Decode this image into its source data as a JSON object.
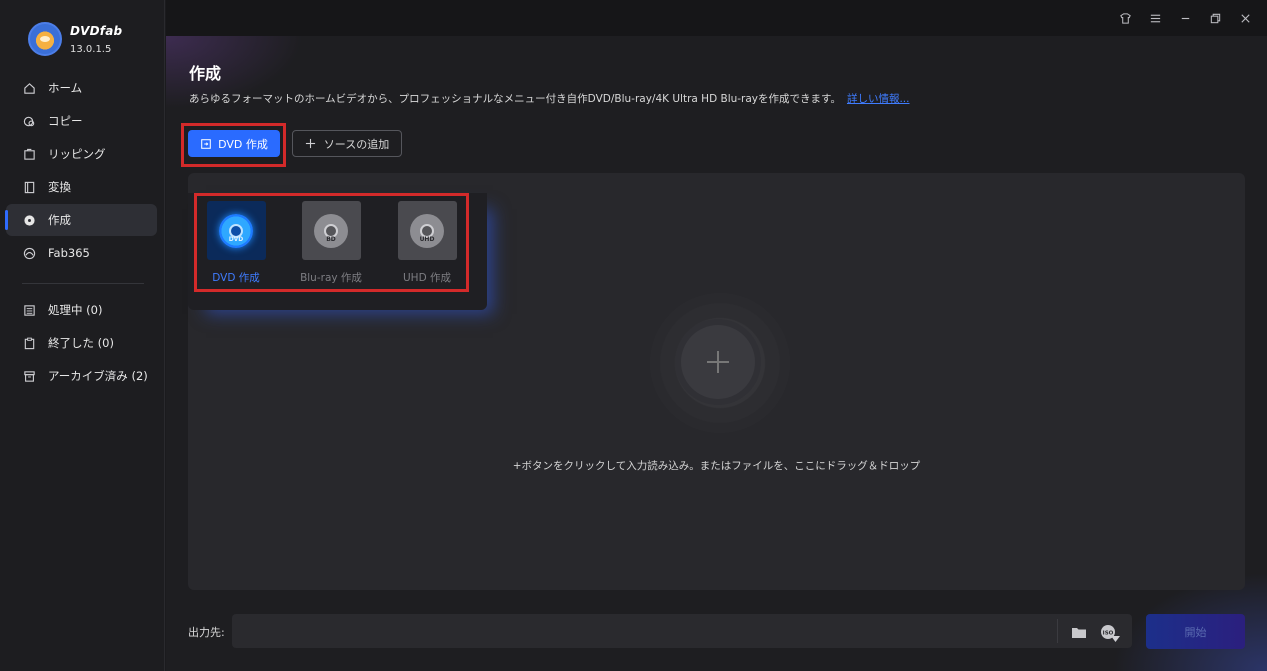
{
  "app": {
    "brand": "DVDfab",
    "version": "13.0.1.5"
  },
  "sidebar": {
    "items": [
      {
        "label": "ホーム",
        "icon": "home-icon"
      },
      {
        "label": "コピー",
        "icon": "copy-icon"
      },
      {
        "label": "リッピング",
        "icon": "ripper-icon"
      },
      {
        "label": "変換",
        "icon": "convert-icon"
      },
      {
        "label": "作成",
        "icon": "creator-icon",
        "active": true
      },
      {
        "label": "Fab365",
        "icon": "fab365-icon"
      }
    ],
    "queue": [
      {
        "label": "処理中 (0)",
        "icon": "processing-icon"
      },
      {
        "label": "終了した (0)",
        "icon": "finished-icon"
      },
      {
        "label": "アーカイブ済み (2)",
        "icon": "archive-icon"
      }
    ]
  },
  "titlebar": {
    "icons": [
      "skin-icon",
      "menu-icon",
      "minimize-icon",
      "restore-icon",
      "close-icon"
    ]
  },
  "main": {
    "title": "作成",
    "description": "あらゆるフォーマットのホームビデオから、プロフェッショナルなメニュー付き自作DVD/Blu-ray/4K Ultra HD Blu-rayを作成できます。",
    "more_link": "詳しい情報...",
    "create_button": "DVD 作成",
    "add_source_button": "ソースの追加",
    "types": [
      {
        "label": "DVD 作成",
        "tag": "DVD",
        "active": true
      },
      {
        "label": "Blu-ray 作成",
        "tag": "BD"
      },
      {
        "label": "UHD 作成",
        "tag": "UHD"
      }
    ],
    "drop_text": "+ボタンをクリックして入力読み込み。またはファイルを、ここにドラッグ＆ドロップ"
  },
  "output": {
    "label": "出力先:",
    "value": "",
    "start_button": "開始"
  },
  "colors": {
    "accent": "#2a6bff",
    "highlight": "#d32a2a"
  }
}
